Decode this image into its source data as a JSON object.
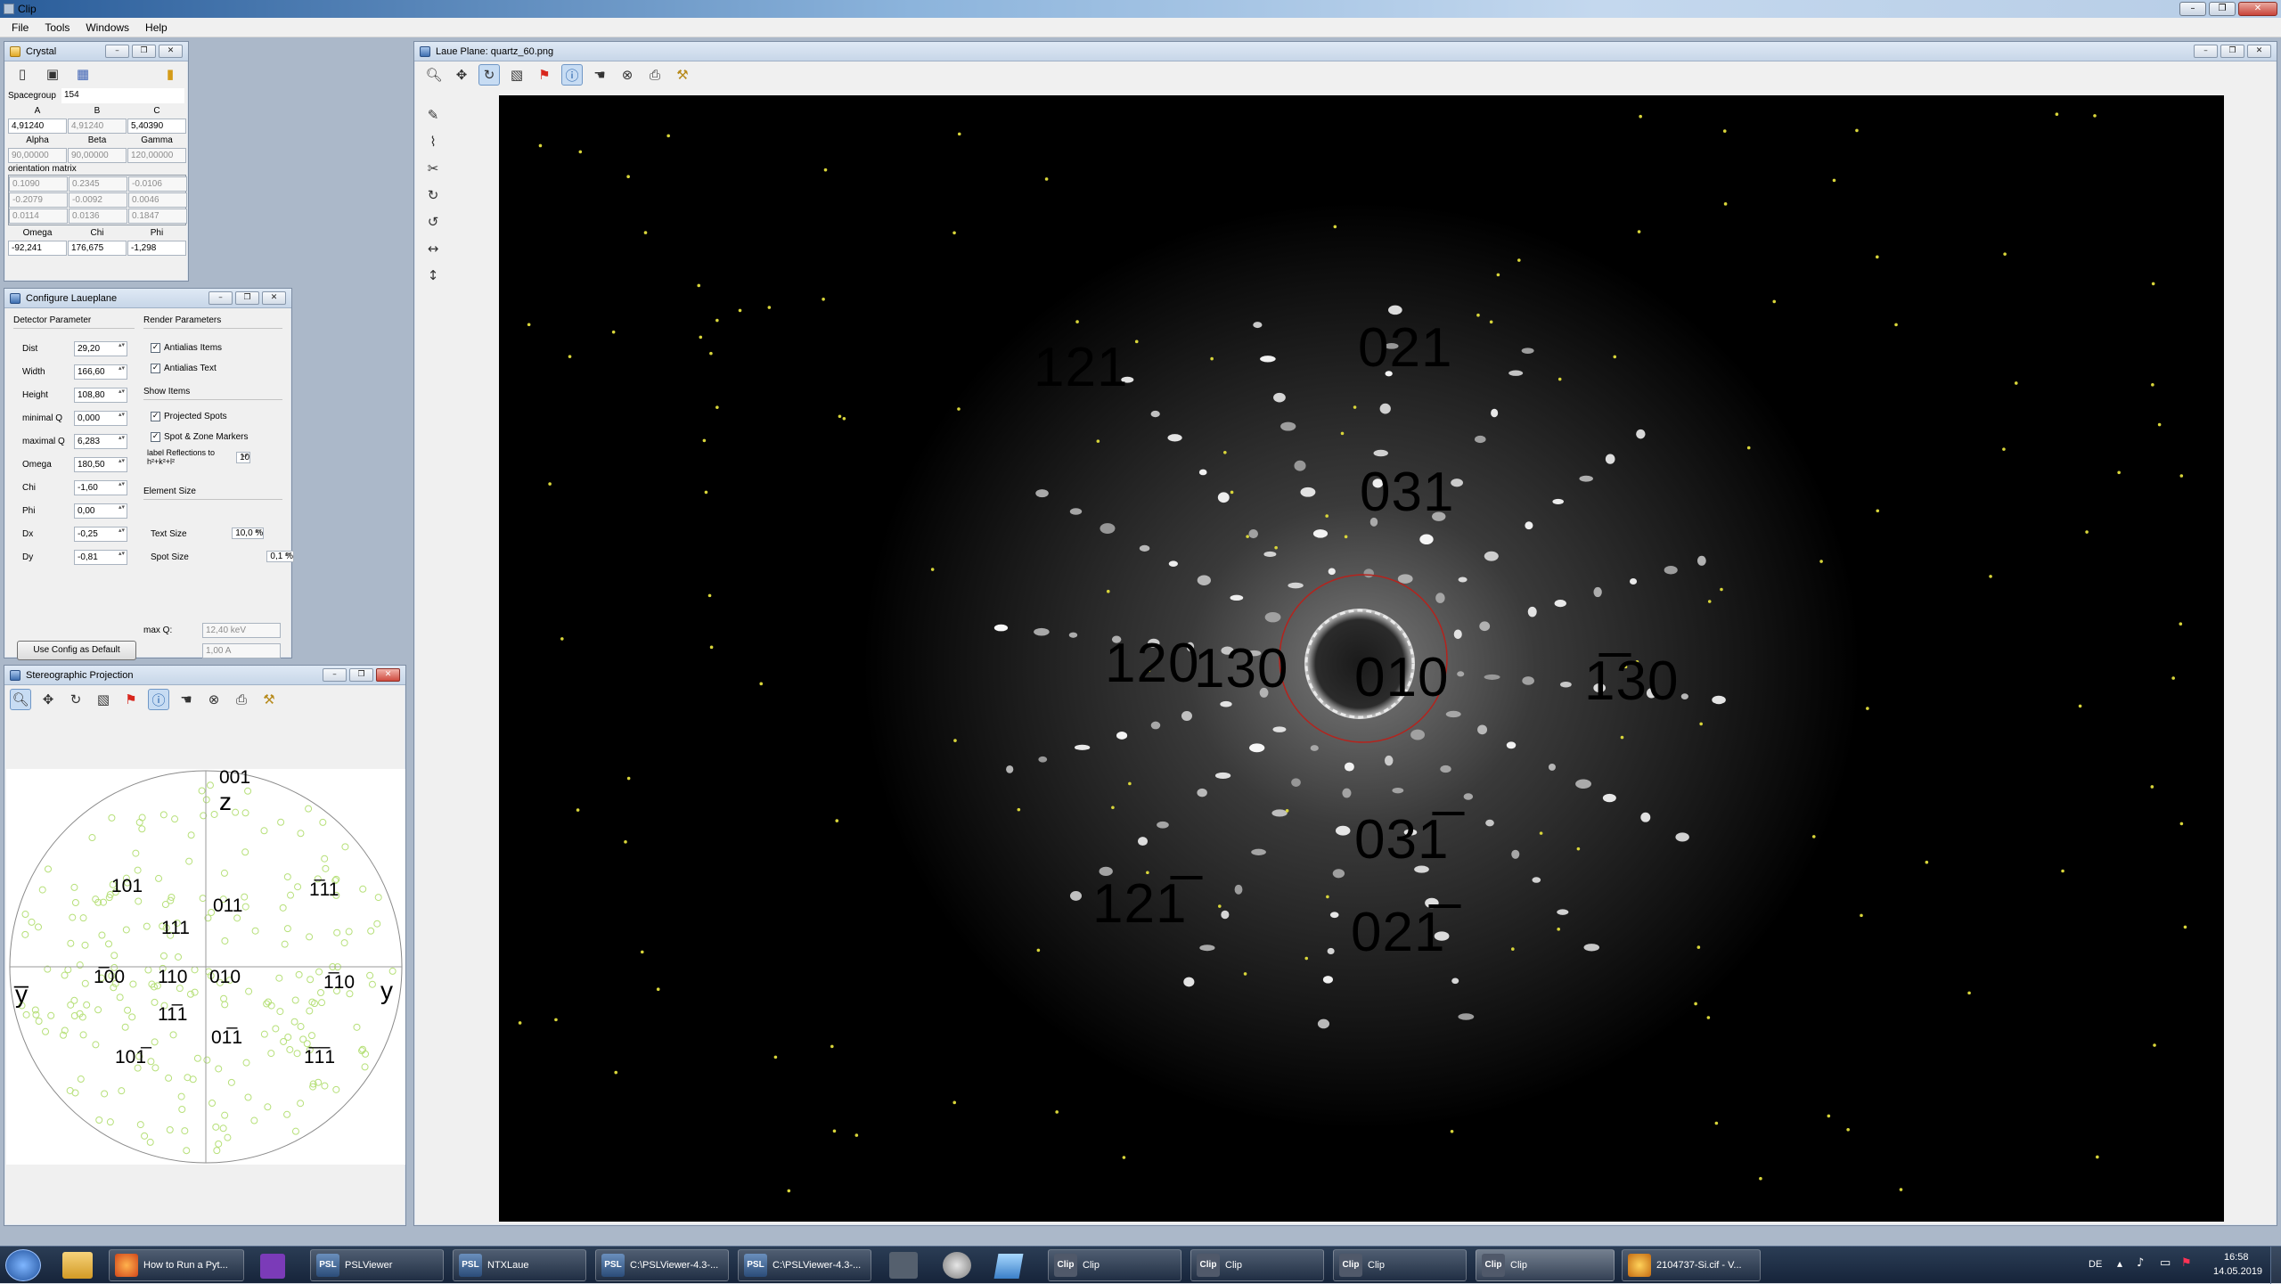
{
  "app": {
    "title": "Clip"
  },
  "menu": [
    "File",
    "Tools",
    "Windows",
    "Help"
  ],
  "crystal": {
    "title": "Crystal",
    "spacegroup_label": "Spacegroup",
    "spacegroup": "154",
    "abc_headers": [
      "A",
      "B",
      "C"
    ],
    "abc": [
      "4,91240",
      "4,91240",
      "5,40390"
    ],
    "angle_headers": [
      "Alpha",
      "Beta",
      "Gamma"
    ],
    "angles": [
      "90,00000",
      "90,00000",
      "120,00000"
    ],
    "matrix_label": "orientation matrix",
    "matrix": [
      [
        "0.1090",
        "0.2345",
        "-0.0106"
      ],
      [
        "-0.2079",
        "-0.0092",
        "0.0046"
      ],
      [
        "0.0114",
        "0.0136",
        "0.1847"
      ]
    ],
    "euler_headers": [
      "Omega",
      "Chi",
      "Phi"
    ],
    "euler": [
      "-92,241",
      "176,675",
      "-1,298"
    ]
  },
  "configure": {
    "title": "Configure Laueplane",
    "detector_label": "Detector Parameter",
    "render_label": "Render Parameters",
    "params": [
      {
        "label": "Dist",
        "value": "29,20"
      },
      {
        "label": "Width",
        "value": "166,60"
      },
      {
        "label": "Height",
        "value": "108,80"
      },
      {
        "label": "minimal Q",
        "value": "0,000"
      },
      {
        "label": "maximal Q",
        "value": "6,283"
      },
      {
        "label": "Omega",
        "value": "180,50"
      },
      {
        "label": "Chi",
        "value": "-1,60"
      },
      {
        "label": "Phi",
        "value": "0,00"
      },
      {
        "label": "Dx",
        "value": "-0,25"
      },
      {
        "label": "Dy",
        "value": "-0,81"
      }
    ],
    "antialias_items": "Antialias Items",
    "antialias_text": "Antialias Text",
    "show_items_label": "Show Items",
    "projected_spots": "Projected Spots",
    "spot_zone_markers": "Spot & Zone Markers",
    "label_reflections": "label Reflections to h²+k²+l²",
    "label_reflections_value": "10",
    "element_size_label": "Element Size",
    "text_size_label": "Text Size",
    "text_size": "10,0 %",
    "spot_size_label": "Spot Size",
    "spot_size": "0,1 %",
    "maxq_label": "max Q:",
    "maxq_kev": "12,40 keV",
    "maxq_a": "1,00 A",
    "default_button": "Use Config as Default"
  },
  "stereo": {
    "title": "Stereographic Projection",
    "labels": [
      "001",
      "z",
      "101",
      "1̅11",
      "011",
      "111",
      "1̅00",
      "110",
      "010",
      "1̅10",
      "y̅",
      "y",
      "11̅1",
      "01̅1",
      "101̅",
      "1̅1̅1"
    ]
  },
  "laue": {
    "title": "Laue Plane: quartz_60.png",
    "labels": [
      "121",
      "021",
      "031",
      "120",
      "130",
      "010",
      "1̅30",
      "031̅",
      "121̅",
      "021̅"
    ]
  },
  "taskbar": {
    "items": [
      "How to Run a Pyt...",
      "PSLViewer",
      "NTXLaue",
      "C:\\PSLViewer-4.3-...",
      "C:\\PSLViewer-4.3-...",
      "Clip",
      "Clip",
      "Clip",
      "Clip",
      "2104737-Si.cif - V..."
    ],
    "lang": "DE",
    "time": "16:58",
    "date": "14.05.2019"
  }
}
